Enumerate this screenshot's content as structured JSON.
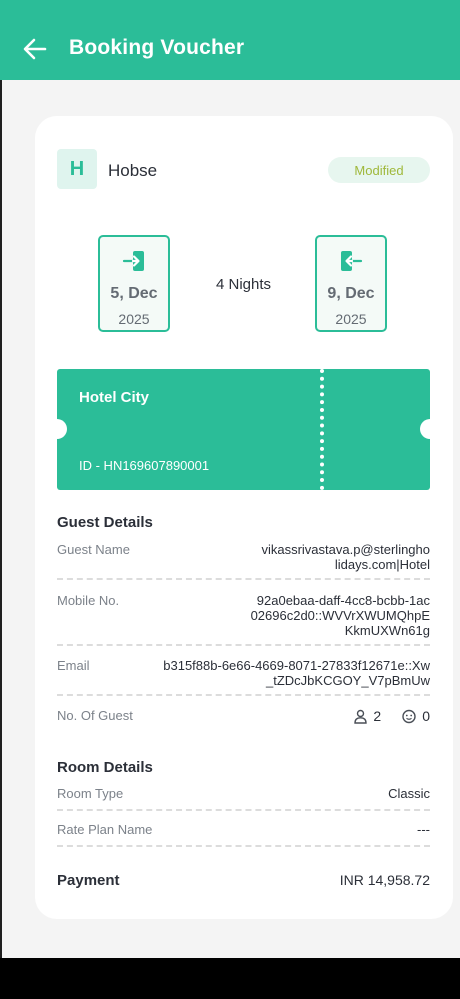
{
  "header": {
    "title": "Booking Voucher",
    "back_icon": "arrow-left-icon"
  },
  "hotel": {
    "initial": "H",
    "name": "Hobse",
    "status": "Modified"
  },
  "stay": {
    "checkin": {
      "day": "5, Dec",
      "year": "2025",
      "icon": "checkin-icon"
    },
    "checkout": {
      "day": "9, Dec",
      "year": "2025",
      "icon": "checkout-icon"
    },
    "nights": "4 Nights"
  },
  "ticket": {
    "hotel_name": "Hotel City",
    "booking_id": "ID - HN169607890001"
  },
  "guest_details": {
    "heading": "Guest Details",
    "guest_name_label": "Guest Name",
    "guest_name_line1": "vikassrivastava.p@sterlingho",
    "guest_name_line2": "lidays.com|Hotel",
    "mobile_label": "Mobile No.",
    "mobile_line1": "92a0ebaa-daff-4cc8-bcbb-1ac",
    "mobile_line2": "02696c2d0::WVVrXWUMQhpE",
    "mobile_line3": "KkmUXWn61g",
    "email_label": "Email",
    "email_line1": "b315f88b-6e66-4669-8071-27833f12671e::Xw",
    "email_line2": "_tZDcJbKCGOY_V7pBmUw",
    "guests_label": "No. Of Guest",
    "adults": "2",
    "children": "0"
  },
  "room_details": {
    "heading": "Room Details",
    "room_type_label": "Room Type",
    "room_type": "Classic",
    "rate_plan_label": "Rate Plan Name",
    "rate_plan": "---"
  },
  "payment": {
    "label": "Payment",
    "amount": "INR 14,958.72"
  },
  "colors": {
    "accent": "#2bbd98",
    "badge_text": "#9fb83a",
    "badge_bg": "#e7f6ef"
  }
}
